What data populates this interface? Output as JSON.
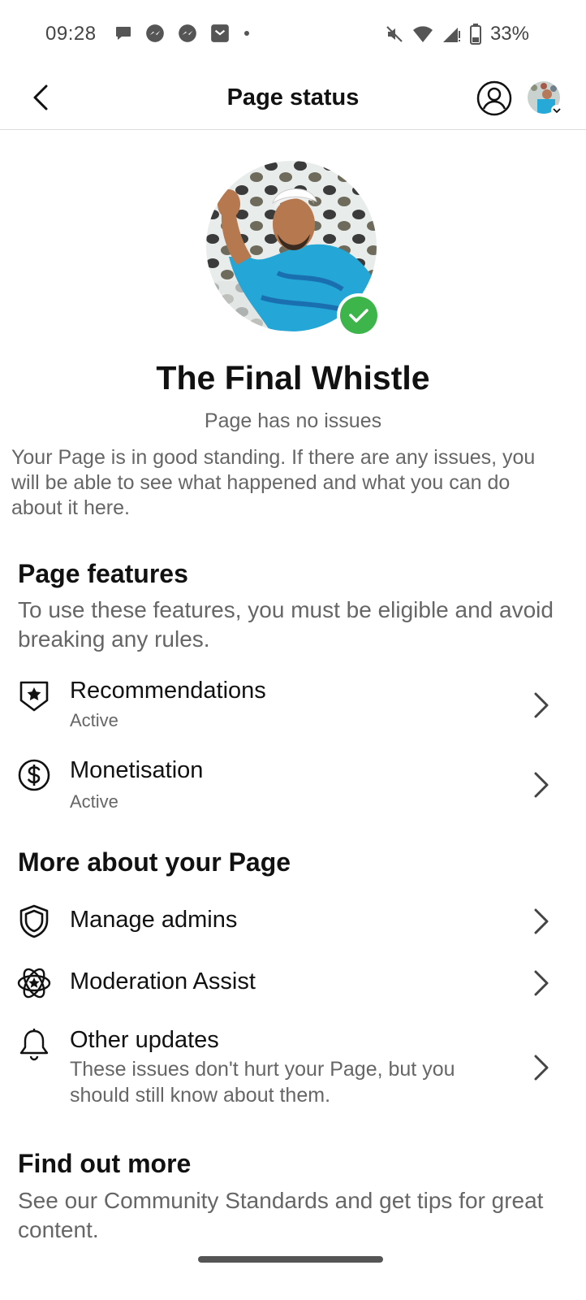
{
  "status_bar": {
    "time": "09:28",
    "battery": "33%"
  },
  "header": {
    "title": "Page status"
  },
  "page": {
    "name": "The Final Whistle",
    "status": "Page has no issues",
    "standing": "Your Page is in good standing. If there are any issues, you will be able to see what happened and what you can do about it here."
  },
  "features": {
    "title": "Page features",
    "description": "To use these features, you must be eligible and avoid breaking any rules.",
    "items": [
      {
        "label": "Recommendations",
        "status": "Active"
      },
      {
        "label": "Monetisation",
        "status": "Active"
      }
    ]
  },
  "more": {
    "title": "More about your Page",
    "items": [
      {
        "label": "Manage admins"
      },
      {
        "label": "Moderation Assist"
      },
      {
        "label": "Other updates",
        "description": "These issues don't hurt your Page, but you should still know about them."
      }
    ]
  },
  "find_out": {
    "title": "Find out more",
    "description": "See our Community Standards and get tips for great content."
  },
  "colors": {
    "verified_green": "#3db54a",
    "secondary_text": "#666666"
  }
}
